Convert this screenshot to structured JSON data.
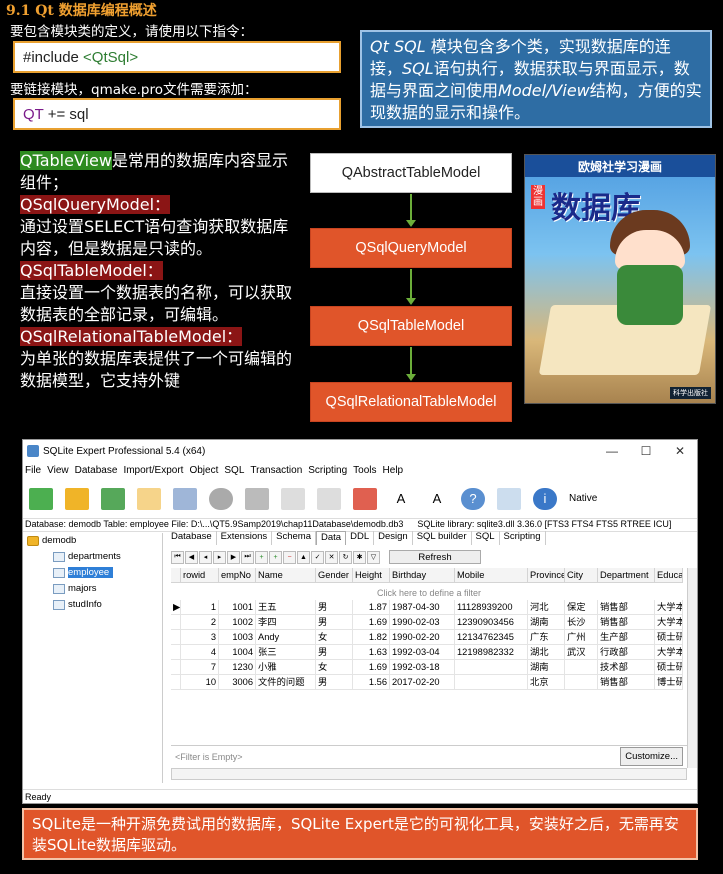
{
  "heading": "9.1 Qt 数据库编程概述",
  "include_desc": "要包含模块类的定义，请使用以下指令：",
  "include_code": {
    "prefix": "#include ",
    "header": "<QtSql>"
  },
  "link_desc": "要链接模块，qmake.pro文件需要添加：",
  "link_code": {
    "keyword": "QT",
    "rest": " += sql"
  },
  "infobox": {
    "lead": "Qt SQL",
    "text1": " 模块包含多个类，实现数据库的连接，",
    "sql": "SQL",
    "text2": "语句执行，数据获取与界面显示，数据与界面之间使用",
    "mv": "Model/View",
    "text3": "结构，方便的实现数据的显示和操作。"
  },
  "left": {
    "tableview_name": "QTableView",
    "tableview_desc": "是常用的数据库内容显示组件；",
    "query_name": "QSqlQueryModel：",
    "query_desc": "通过设置SELECT语句查询获取数据库内容，但是数据是只读的。",
    "table_name": "QSqlTableModel：",
    "table_desc": "直接设置一个数据表的名称，可以获取数据表的全部记录，可编辑。",
    "rel_name": "QSqlRelationalTableModel：",
    "rel_desc": "为单张的数据库表提供了一个可编辑的数据模型，它支持外键"
  },
  "diagram": [
    "QAbstractTableModel",
    "QSqlQueryModel",
    "QSqlTableModel",
    "QSqlRelationalTableModel"
  ],
  "book": {
    "banner": "欧姆社学习漫画",
    "tag": "漫画",
    "title": "数据库",
    "publisher": "科学出版社"
  },
  "window": {
    "title": "SQLite Expert Professional 5.4 (x64)",
    "controls": [
      "—",
      "☐",
      "✕"
    ],
    "menu": [
      "File",
      "View",
      "Database",
      "Import/Export",
      "Object",
      "SQL",
      "Transaction",
      "Scripting",
      "Tools",
      "Help"
    ],
    "native_label": "Native",
    "path": "Database: demodb   Table: employee   File: D:\\...\\QT5.9Samp2019\\chap11Database\\demodb.db3",
    "library": "SQLite library: sqlite3.dll 3.36.0 [FTS3 FTS4 FTS5 RTREE ICU]",
    "tree": {
      "db": "demodb",
      "tables": [
        "departments",
        "employee",
        "majors",
        "studInfo"
      ]
    },
    "tabs": [
      "Database",
      "Extensions",
      "Schema",
      "Data",
      "DDL",
      "Design",
      "SQL builder",
      "SQL",
      "Scripting"
    ],
    "active_tab": "Data",
    "refresh_label": "Refresh",
    "filter_hint": "Click here to define a filter",
    "columns": [
      "rowid",
      "empNo",
      "Name",
      "Gender",
      "Height",
      "Birthday",
      "Mobile",
      "Province",
      "City",
      "Department",
      "Educa"
    ],
    "rows": [
      [
        "1",
        "1001",
        "王五",
        "男",
        "1.87",
        "1987-04-30",
        "11128939200",
        "河北",
        "保定",
        "销售部",
        "大学本"
      ],
      [
        "2",
        "1002",
        "李四",
        "男",
        "1.69",
        "1990-02-03",
        "12390903456",
        "湖南",
        "长沙",
        "销售部",
        "大学本"
      ],
      [
        "3",
        "1003",
        "Andy",
        "女",
        "1.82",
        "1990-02-20",
        "12134762345",
        "广东",
        "广州",
        "生产部",
        "硕士研"
      ],
      [
        "4",
        "1004",
        "张三",
        "男",
        "1.63",
        "1992-03-04",
        "12198982332",
        "湖北",
        "武汉",
        "行政部",
        "大学本"
      ],
      [
        "7",
        "1230",
        "小雅",
        "女",
        "1.69",
        "1992-03-18",
        "",
        "湖南",
        "",
        "技术部",
        "硕士研"
      ],
      [
        "10",
        "3006",
        "文件的问题",
        "男",
        "1.56",
        "2017-02-20",
        "",
        "北京",
        "",
        "销售部",
        "博士研"
      ]
    ],
    "filter_empty": "<Filter is Empty>",
    "customize_label": "Customize...",
    "status": "Ready"
  },
  "footer": "SQLite是一种开源免费试用的数据库，SQLite Expert是它的可视化工具，安装好之后，无需再安装SQLite数据库驱动。"
}
